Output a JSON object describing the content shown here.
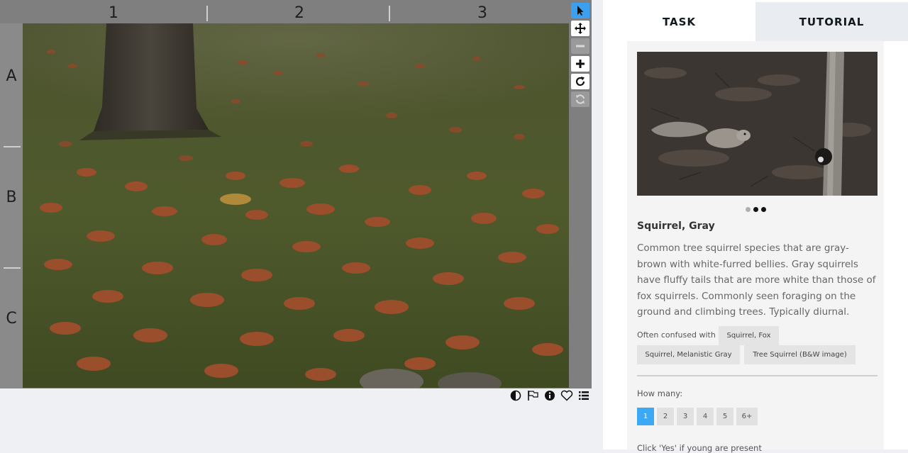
{
  "viewer": {
    "columns": [
      "1",
      "2",
      "3"
    ],
    "rows": [
      "A",
      "B",
      "C"
    ],
    "tools": [
      {
        "name": "pointer-icon",
        "state": "active"
      },
      {
        "name": "move-icon",
        "state": "normal"
      },
      {
        "name": "zoom-out-icon",
        "state": "disabled"
      },
      {
        "name": "zoom-in-icon",
        "state": "normal"
      },
      {
        "name": "rotate-icon",
        "state": "normal"
      },
      {
        "name": "reset-icon",
        "state": "disabled"
      }
    ],
    "bottom_icons": [
      "contrast-icon",
      "flag-icon",
      "info-icon",
      "heart-icon",
      "list-icon"
    ]
  },
  "tabs": [
    {
      "label": "TASK",
      "active": true
    },
    {
      "label": "TUTORIAL",
      "active": false
    }
  ],
  "species": {
    "name": "Squirrel, Gray",
    "description": "Common tree squirrel species that are gray-brown with white-furred bellies. Gray squirrels have fluffy tails that are more white than those of fox squirrels. Commonly seen foraging on the ground and climbing trees. Typically diurnal.",
    "carousel_dots": 3,
    "carousel_active": 1,
    "confused_label": "Often confused with",
    "confused_with": [
      "Squirrel, Fox",
      "Squirrel, Melanistic Gray",
      "Tree Squirrel (B&W image)"
    ]
  },
  "question": {
    "label": "How many:",
    "options": [
      "1",
      "2",
      "3",
      "4",
      "5",
      "6+"
    ],
    "selected": "1"
  },
  "young_label": "Click 'Yes' if young are present",
  "colors": {
    "accent": "#3ba9f3",
    "viewer_frame": "#7f7f7f",
    "panel_bg": "#f4f4f4"
  }
}
